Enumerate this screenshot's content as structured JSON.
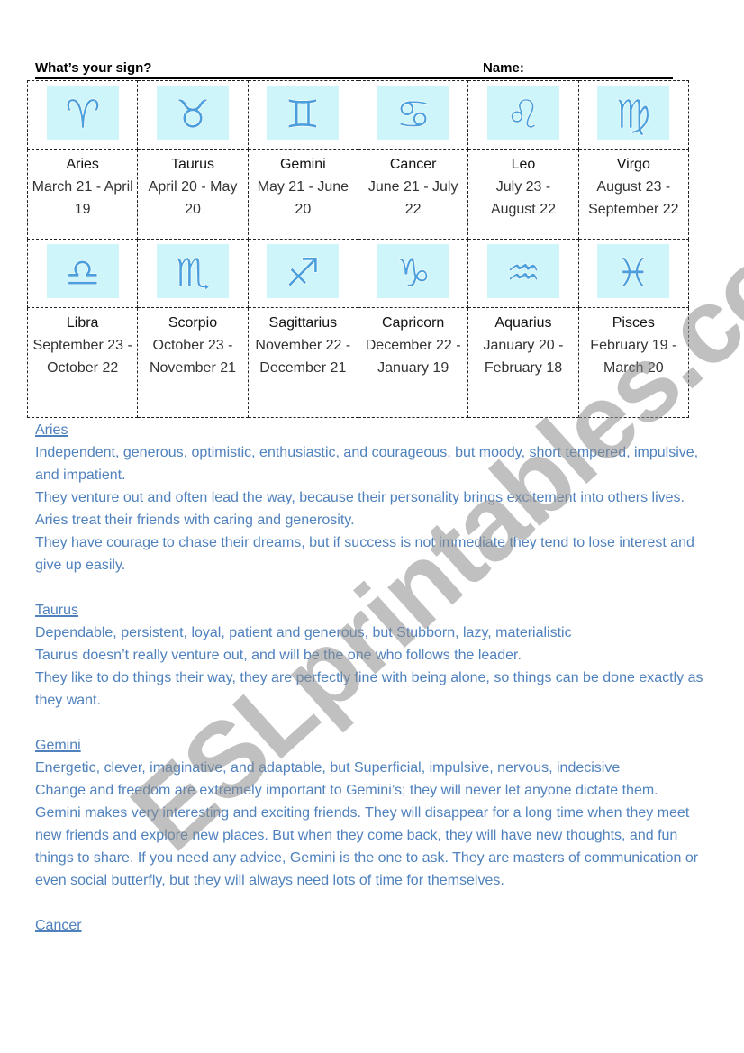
{
  "header": {
    "title": "What’s your sign?",
    "name_label": "Name:"
  },
  "signs": [
    {
      "name": "Aries",
      "dates": "March 21 - April 19",
      "icon": "aries-icon",
      "glyph": "♈"
    },
    {
      "name": "Taurus",
      "dates": "April 20 - May 20",
      "icon": "taurus-icon",
      "glyph": "♉"
    },
    {
      "name": "Gemini",
      "dates": "May 21 - June 20",
      "icon": "gemini-icon",
      "glyph": "♊"
    },
    {
      "name": "Cancer",
      "dates": "June 21 - July 22",
      "icon": "cancer-icon",
      "glyph": "♋"
    },
    {
      "name": "Leo",
      "dates": "July 23 - August 22",
      "icon": "leo-icon",
      "glyph": "♌"
    },
    {
      "name": "Virgo",
      "dates": "August 23 - September 22",
      "icon": "virgo-icon",
      "glyph": "♍"
    },
    {
      "name": "Libra",
      "dates": "September 23 - October 22",
      "icon": "libra-icon",
      "glyph": "♎"
    },
    {
      "name": "Scorpio",
      "dates": "October 23 - November 21",
      "icon": "scorpio-icon",
      "glyph": "♏"
    },
    {
      "name": "Sagittarius",
      "dates": "November 22 - December 21",
      "icon": "sagittarius-icon",
      "glyph": "♐"
    },
    {
      "name": "Capricorn",
      "dates": "December 22 - January 19",
      "icon": "capricorn-icon",
      "glyph": "♑"
    },
    {
      "name": "Aquarius",
      "dates": "January 20 - February 18",
      "icon": "aquarius-icon",
      "glyph": "♒"
    },
    {
      "name": "Pisces",
      "dates": "February 19 - March 20",
      "icon": "pisces-icon",
      "glyph": "♓"
    }
  ],
  "sections": [
    {
      "title": "Aries",
      "paragraphs": [
        "Independent, generous, optimistic, enthusiastic, and courageous, but moody, short tempered, impulsive, and impatient.",
        "They venture out and often lead the way, because their personality brings excitement into others lives.",
        "Aries treat their friends with caring and generosity.",
        "They have courage to chase their dreams, but if success is not immediate they tend to lose interest and give up easily."
      ]
    },
    {
      "title": "Taurus",
      "paragraphs": [
        "Dependable, persistent, loyal, patient and generous, but Stubborn, lazy, materialistic",
        "Taurus doesn’t really venture out, and will be the one who follows the leader.",
        "They like to do things their way, they are perfectly fine with being alone, so things can be done exactly as they want."
      ]
    },
    {
      "title": "Gemini",
      "paragraphs": [
        "Energetic, clever, imaginative, and adaptable, but Superficial, impulsive, nervous, indecisive",
        "Change and freedom are extremely important to Gemini’s; they will never let anyone dictate them.",
        "Gemini makes very interesting and exciting friends. They will disappear for a long time when they meet new friends and explore new places. But when they come back, they will have new thoughts, and fun things to share. If you need any advice, Gemini is the one to ask. They are masters of communication or even social butterfly, but they will always need lots of time for themselves."
      ]
    },
    {
      "title": "Cancer",
      "paragraphs": []
    }
  ],
  "watermark": "ESLprintables.com",
  "colors": {
    "body_text": "#4f81bd",
    "icon_bg": "#cdf5fa",
    "icon_glyph": "#4a9fdc"
  }
}
